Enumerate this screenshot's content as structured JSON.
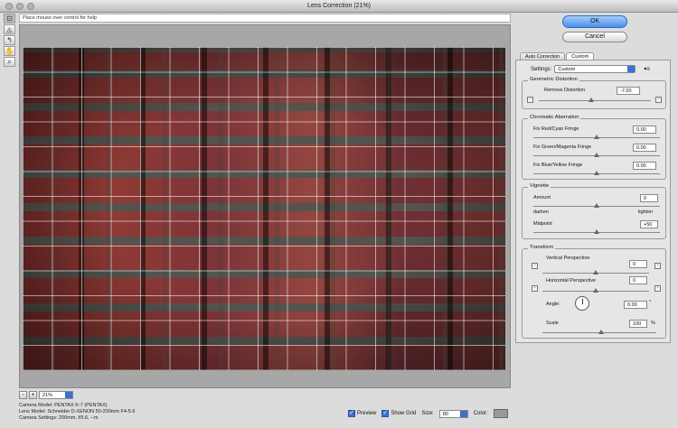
{
  "window": {
    "title": "Lens Correction (21%)"
  },
  "help": {
    "text": "Place mouse over control for help"
  },
  "tools": [
    {
      "name": "remove-distortion-tool",
      "glyph": "⊡"
    },
    {
      "name": "straighten-tool",
      "glyph": "◬"
    },
    {
      "name": "move-grid-tool",
      "glyph": "↰"
    },
    {
      "name": "hand-tool",
      "glyph": "✋"
    },
    {
      "name": "zoom-tool",
      "glyph": "⌕"
    }
  ],
  "zoom": {
    "minus": "-",
    "plus": "+",
    "value": "21%"
  },
  "camera_info": {
    "model": "Camera Model: PENTAX K-7 (PENTAX)",
    "lens": "Lens Model: Schneider D-XENON 50-200mm F4-5.6",
    "settings": "Camera Settings: 200mm, f/5.6, --m"
  },
  "bottom": {
    "preview_label": "Preview",
    "show_grid_label": "Show Grid",
    "size_label": "Size:",
    "size_value": "80",
    "color_label": "Color:",
    "grid_color": "#9a9a9a"
  },
  "buttons": {
    "ok": "OK",
    "cancel": "Cancel"
  },
  "tabs": {
    "auto": "Auto Correction",
    "custom": "Custom"
  },
  "panel": {
    "settings_label": "Settings:",
    "settings_value": "Custom",
    "geometric": {
      "title": "Geometric Distortion",
      "remove_label": "Remove Distortion",
      "remove_value": "-7.00",
      "remove_level": -7
    },
    "chromatic": {
      "title": "Chromatic Aberration",
      "red_label": "Fix Red/Cyan Fringe",
      "red_value": "0.00",
      "green_label": "Fix Green/Magenta Fringe",
      "green_value": "0.00",
      "blue_label": "Fix Blue/Yellow Fringe",
      "blue_value": "0.00"
    },
    "vignette": {
      "title": "Vignette",
      "amount_label": "Amount",
      "amount_value": "0",
      "darken": "darken",
      "lighten": "lighten",
      "midpoint_label": "Midpoint",
      "midpoint_value": "+50"
    },
    "transform": {
      "title": "Transform",
      "vertical_label": "Vertical Perspective",
      "vertical_value": "0",
      "horizontal_label": "Horizontal Perspective",
      "horizontal_value": "0",
      "angle_label": "Angle:",
      "angle_value": "0.00",
      "angle_unit": "°",
      "scale_label": "Scale",
      "scale_value": "100",
      "scale_unit": "%"
    }
  },
  "colors": {
    "accent": "#3c6fd1",
    "ok_button": "#4a8fe8"
  }
}
